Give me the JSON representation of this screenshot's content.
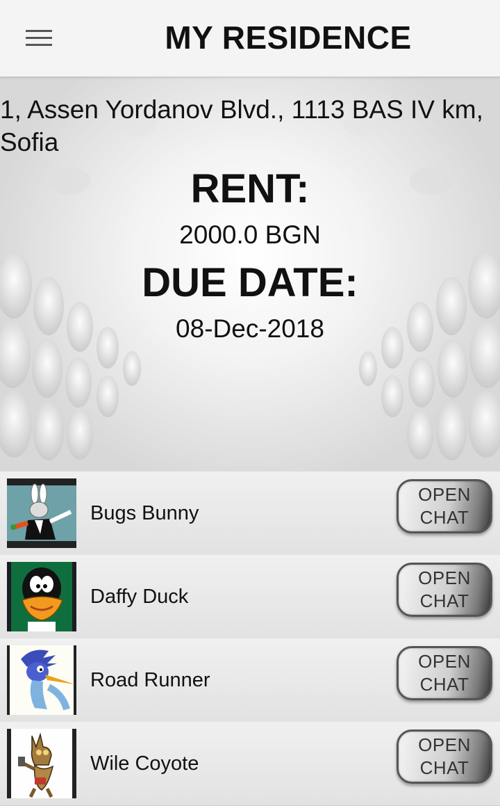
{
  "app_bar": {
    "title": "MY RESIDENCE",
    "menu_icon": "hamburger-menu-icon"
  },
  "residence": {
    "address": "1, Assen Yordanov Blvd., 1113 BAS IV km, Sofia",
    "rent_label": "RENT:",
    "rent_value": "2000.0 BGN",
    "due_label": "DUE DATE:",
    "due_value": "08-Dec-2018"
  },
  "contacts": [
    {
      "name": "Bugs Bunny",
      "button": [
        "OPEN",
        "CHAT"
      ]
    },
    {
      "name": "Daffy Duck",
      "button": [
        "OPEN",
        "CHAT"
      ]
    },
    {
      "name": "Road Runner",
      "button": [
        "OPEN",
        "CHAT"
      ]
    },
    {
      "name": "Wile Coyote",
      "button": [
        "OPEN",
        "CHAT"
      ]
    }
  ]
}
